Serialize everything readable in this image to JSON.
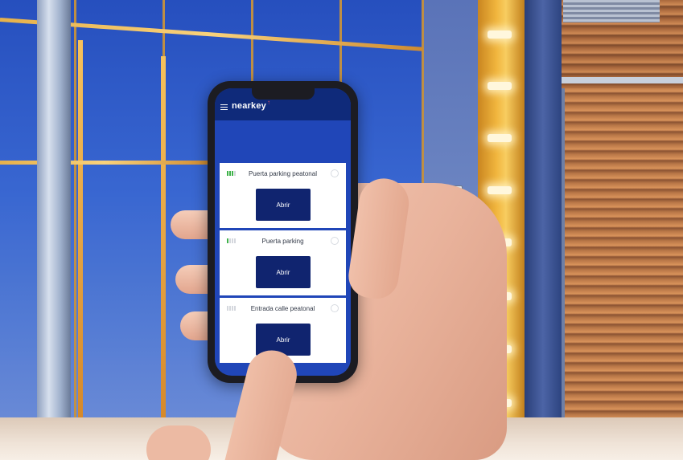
{
  "app": {
    "brand": "nearkey",
    "brand_mark": "↑",
    "colors": {
      "appbar": "#0f2a7a",
      "background": "#2046b8",
      "button": "#10246f",
      "signal_active": "#3fb24a"
    }
  },
  "doors": [
    {
      "name": "Puerta parking peatonal",
      "signal_level": 3,
      "button_label": "Abrir"
    },
    {
      "name": "Puerta parking",
      "signal_level": 1,
      "button_label": "Abrir"
    },
    {
      "name": "Entrada calle peatonal",
      "signal_level": 0,
      "button_label": "Abrir"
    }
  ],
  "icons": {
    "menu": "menu-icon",
    "user": "user-icon",
    "signal": "signal-icon"
  }
}
